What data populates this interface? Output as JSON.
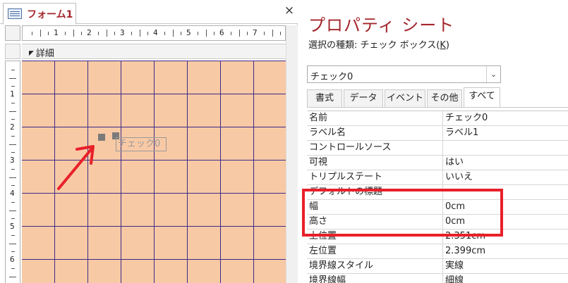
{
  "designer": {
    "tab_title": "フォーム1",
    "close_glyph": "×",
    "section_label": "詳細",
    "ruler_numbers_h": [
      "1",
      "2",
      "3",
      "4",
      "5",
      "6",
      "7"
    ],
    "ruler_numbers_v": [
      "1",
      "2",
      "3",
      "4",
      "5",
      "6"
    ],
    "control_label": "チェック0",
    "colors": {
      "canvas": "#f8c9a5",
      "grid_line": "#3c2a8a",
      "annotation_red": "#e8202a"
    }
  },
  "property_sheet": {
    "title": "プロパティ シート",
    "selection_type_label": "選択の種類: チェック ボックス(",
    "selection_type_key": "K",
    "selection_type_close": ")",
    "selected_object": "チェック0",
    "dropdown_icon": "chevron-down-icon",
    "tabs": [
      {
        "label": "書式"
      },
      {
        "label": "データ"
      },
      {
        "label": "イベント"
      },
      {
        "label": "その他"
      },
      {
        "label": "すべて",
        "active": true
      }
    ],
    "properties": [
      {
        "name": "名前",
        "value": "チェック0"
      },
      {
        "name": "ラベル名",
        "value": "ラベル1"
      },
      {
        "name": "コントロールソース",
        "value": ""
      },
      {
        "name": "可視",
        "value": "はい"
      },
      {
        "name": "トリプルステート",
        "value": "いいえ"
      },
      {
        "name": "デフォルトの標題",
        "value": ""
      },
      {
        "name": "幅",
        "value": "0cm"
      },
      {
        "name": "高さ",
        "value": "0cm"
      },
      {
        "name": "上位置",
        "value": "2.351cm"
      },
      {
        "name": "左位置",
        "value": "2.399cm"
      },
      {
        "name": "境界線スタイル",
        "value": "実線"
      },
      {
        "name": "境界線幅",
        "value": "細線"
      }
    ]
  }
}
